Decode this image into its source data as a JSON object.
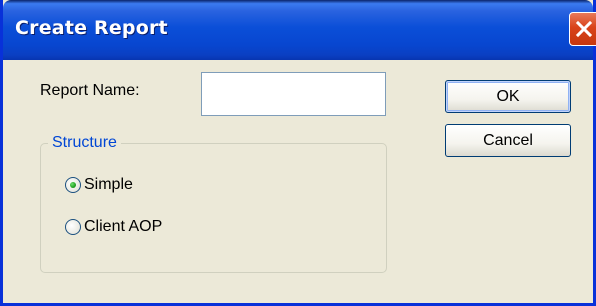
{
  "window": {
    "title": "Create Report"
  },
  "form": {
    "report_name_label": "Report Name:",
    "report_name_value": "",
    "structure_label": "Structure",
    "options": [
      {
        "label": "Simple",
        "selected": true
      },
      {
        "label": "Client AOP",
        "selected": false
      }
    ]
  },
  "buttons": {
    "ok_label": "OK",
    "cancel_label": "Cancel"
  },
  "icons": {
    "close": "close-icon"
  },
  "colors": {
    "titlebar": "#0b4fd8",
    "close_button": "#d9431a",
    "group_label": "#0046d5",
    "dialog_background": "#ece9d8"
  }
}
